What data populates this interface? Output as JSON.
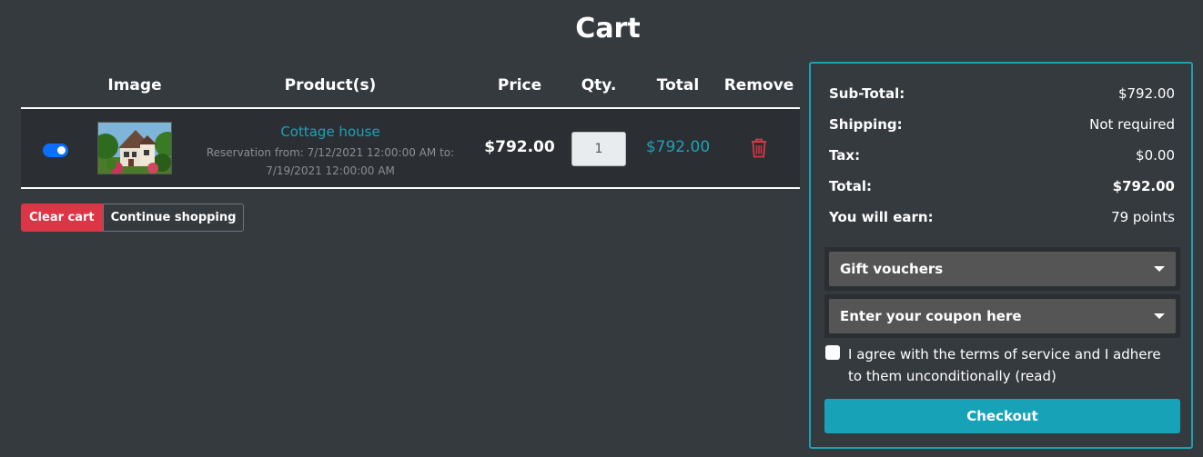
{
  "page": {
    "title": "Cart"
  },
  "table": {
    "headers": {
      "image": "Image",
      "products": "Product(s)",
      "price": "Price",
      "qty": "Qty.",
      "total": "Total",
      "remove": "Remove"
    },
    "rows": [
      {
        "selected": true,
        "name": "Cottage house",
        "attributes": "Reservation from: 7/12/2021 12:00:00 AM to: 7/19/2021 12:00:00 AM",
        "price": "$792.00",
        "qty": "1",
        "total": "$792.00",
        "remove_icon": "trash-icon"
      }
    ]
  },
  "actions": {
    "clear_label": "Clear cart",
    "continue_label": "Continue shopping"
  },
  "summary": {
    "subtotal_label": "Sub-Total:",
    "subtotal_value": "$792.00",
    "shipping_label": "Shipping:",
    "shipping_value": "Not required",
    "tax_label": "Tax:",
    "tax_value": "$0.00",
    "total_label": "Total:",
    "total_value": "$792.00",
    "earn_label": "You will earn:",
    "earn_value": "79 points",
    "gift_vouchers_label": "Gift vouchers",
    "coupon_label": "Enter your coupon here",
    "terms_text": "I agree with the terms of service and I adhere to them unconditionally (read)",
    "checkout_label": "Checkout"
  },
  "colors": {
    "background": "#353a3f",
    "accent": "#17a2b8",
    "danger": "#dc3545",
    "toggle": "#0d6efd"
  }
}
